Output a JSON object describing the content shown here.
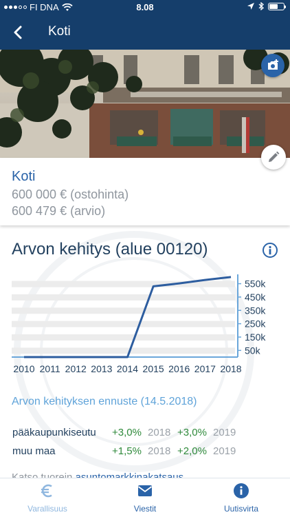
{
  "status_bar": {
    "carrier": "FI DNA",
    "time": "8.08"
  },
  "header": {
    "title": "Koti"
  },
  "property": {
    "name": "Koti",
    "purchase_price": "600 000 € (ostohinta)",
    "estimate": "600 479 € (arvio)"
  },
  "value_section": {
    "title": "Arvon kehitys (alue 00120)"
  },
  "chart_data": {
    "type": "line",
    "x": [
      2010,
      2011,
      2012,
      2013,
      2014,
      2015,
      2016,
      2017,
      2018
    ],
    "series": [
      {
        "values": [
          0,
          0,
          0,
          0,
          0,
          530000,
          552000,
          578000,
          600000
        ]
      }
    ],
    "y_ticks": [
      "550k",
      "450k",
      "350k",
      "250k",
      "150k",
      "50k"
    ],
    "x_ticks": [
      "2010",
      "2011",
      "2012",
      "2013",
      "2014",
      "2015",
      "2016",
      "2017",
      "2018"
    ],
    "ylim": [
      0,
      620000
    ],
    "grid": "horizontal bands",
    "colors": {
      "line": "#2d5d9f",
      "axis": "#6aa6da",
      "band": "#ececec"
    }
  },
  "forecast": {
    "title": "Arvon kehityksen ennuste (14.5.2018)",
    "rows": [
      {
        "region": "pääkaupunkiseutu",
        "p1": "+3,0%",
        "y1": "2018",
        "p2": "+3,0%",
        "y2": "2019"
      },
      {
        "region": "muu maa",
        "p1": "+1,5%",
        "y1": "2018",
        "p2": "+2,0%",
        "y2": "2019"
      }
    ]
  },
  "more": {
    "prefix": "Katso tuorein ",
    "link": "asuntomarkkinakatsaus"
  },
  "tabs": [
    {
      "label": "Varallisuus",
      "icon": "euro-icon"
    },
    {
      "label": "Viestit",
      "icon": "mail-icon"
    },
    {
      "label": "Uutisvirta",
      "icon": "info-icon"
    }
  ],
  "colors": {
    "primary": "#153e6b",
    "accent": "#2a63a8",
    "positive": "#2f8a3b",
    "muted": "#9aa1a8"
  }
}
